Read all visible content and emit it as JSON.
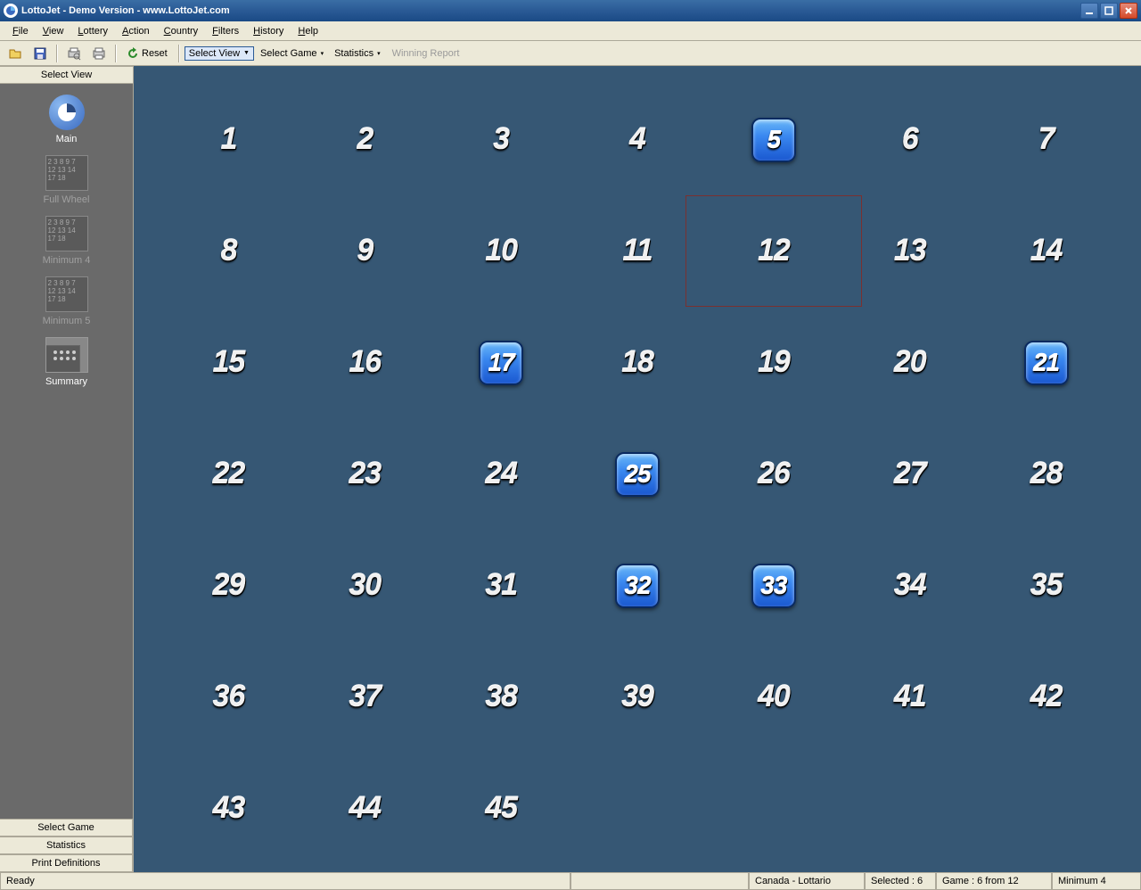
{
  "titlebar": {
    "title": "LottoJet - Demo Version - www.LottoJet.com"
  },
  "menu": {
    "items": [
      "File",
      "View",
      "Lottery",
      "Action",
      "Country",
      "Filters",
      "History",
      "Help"
    ]
  },
  "toolbar": {
    "reset": "Reset",
    "select_view": "Select View",
    "select_game": "Select Game",
    "statistics": "Statistics",
    "winning_report": "Winning Report"
  },
  "sidebar": {
    "header": "Select View",
    "items": [
      {
        "key": "main",
        "label": "Main",
        "icon": "main",
        "state": "active"
      },
      {
        "key": "full_wheel",
        "label": "Full Wheel",
        "icon": "wheel",
        "state": "faded"
      },
      {
        "key": "minimum_4",
        "label": "Minimum 4",
        "icon": "wheel",
        "state": "faded"
      },
      {
        "key": "minimum_5",
        "label": "Minimum 5",
        "icon": "wheel",
        "state": "faded"
      },
      {
        "key": "summary",
        "label": "Summary",
        "icon": "summary",
        "state": "active"
      }
    ],
    "bottom": [
      "Select Game",
      "Statistics",
      "Print Definitions"
    ]
  },
  "grid": {
    "max": 45,
    "selected": [
      5,
      17,
      21,
      25,
      32,
      33
    ],
    "hovered": 12
  },
  "status": {
    "ready": "Ready",
    "country_game": "Canada - Lottario",
    "selected": "Selected :  6",
    "game": "Game :  6 from 12",
    "wheel": "Minimum 4"
  }
}
